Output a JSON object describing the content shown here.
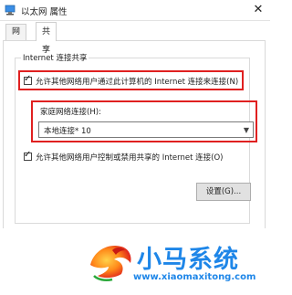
{
  "window": {
    "title": "以太网 属性",
    "close_icon": "close-icon"
  },
  "tabs": [
    {
      "label": "网络",
      "active": false
    },
    {
      "label": "共享",
      "active": true
    }
  ],
  "sharing": {
    "group_title": "Internet 连接共享",
    "allow_connect_label": "允许其他网络用户通过此计算机的 Internet 连接来连接(N)",
    "allow_connect_checked": true,
    "home_network_label": "家庭网络连接(H):",
    "home_network_value": "本地连接* 10",
    "allow_control_label": "允许其他网络用户控制或禁用共享的 Internet 连接(O)",
    "allow_control_checked": true,
    "settings_button": "设置(G)..."
  },
  "brand": {
    "name": "小马系统",
    "url": "www.xiaomaxitong.com",
    "color": "#1e86e8"
  },
  "colors": {
    "highlight": "#e02020",
    "accent": "#1e86e8"
  }
}
